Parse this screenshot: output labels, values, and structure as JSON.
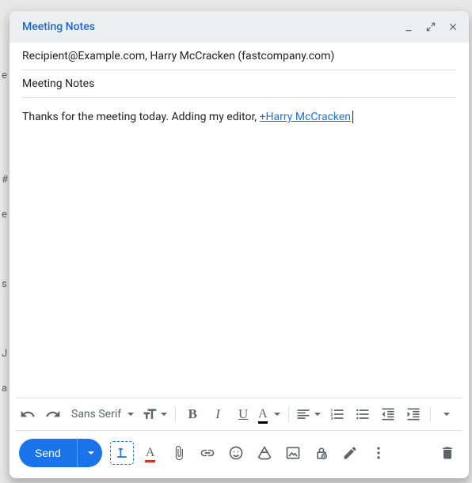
{
  "window": {
    "title": "Meeting Notes"
  },
  "compose": {
    "recipients": "Recipient@Example.com, Harry McCracken (fastcompany.com)",
    "subject": "Meeting Notes",
    "body_text": "Thanks for the meeting today. Adding my editor, ",
    "mention": "+Harry McCracken"
  },
  "format_toolbar": {
    "font_family": "Sans Serif"
  },
  "send": {
    "label": "Send"
  }
}
